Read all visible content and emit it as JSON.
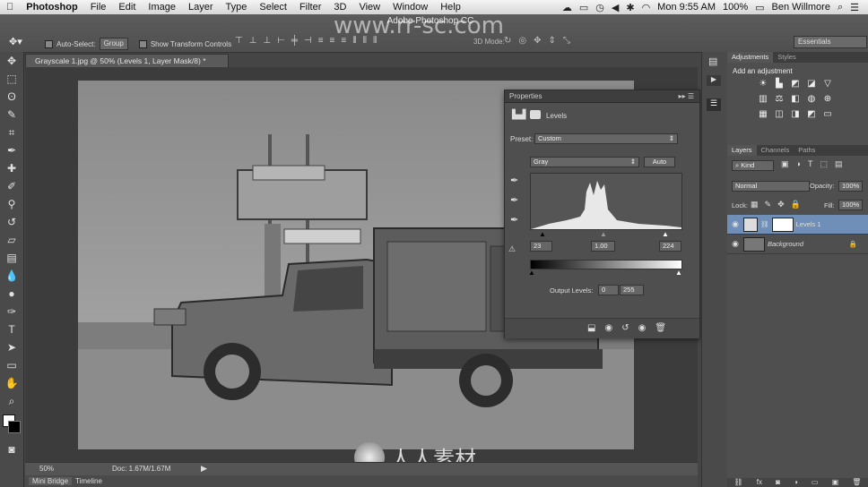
{
  "menubar": {
    "apple": "",
    "app": "Photoshop",
    "items": [
      "File",
      "Edit",
      "Image",
      "Layer",
      "Type",
      "Select",
      "Filter",
      "3D",
      "View",
      "Window",
      "Help"
    ],
    "clock": "Mon 9:55 AM",
    "battery": "100%",
    "user": "Ben Willmore"
  },
  "app_title": "Adobe Photoshop CC",
  "options": {
    "auto_select": "Auto-Select:",
    "auto_select_value": "Group",
    "show_transform": "Show Transform Controls",
    "mode3d": "3D Mode:",
    "workspace": "Essentials"
  },
  "document": {
    "tab_title": "Grayscale 1.jpg @ 50% (Levels 1, Layer Mask/8) *",
    "zoom": "50%",
    "doc_info": "Doc: 1.67M/1.67M"
  },
  "bottom_tabs": [
    "Mini Bridge",
    "Timeline"
  ],
  "properties": {
    "panel_title": "Properties",
    "section": "Levels",
    "preset_label": "Preset:",
    "preset_value": "Custom",
    "channel": "Gray",
    "auto": "Auto",
    "input_black": "23",
    "input_gamma": "1.00",
    "input_white": "224",
    "output_label": "Output Levels:",
    "output_black": "0",
    "output_white": "255"
  },
  "adjustments": {
    "tab_active": "Adjustments",
    "tab_other": "Styles",
    "heading": "Add an adjustment"
  },
  "layers": {
    "tabs": [
      "Layers",
      "Channels",
      "Paths"
    ],
    "kind": "Kind",
    "blend_mode": "Normal",
    "opacity_label": "Opacity:",
    "opacity": "100%",
    "lock_label": "Lock:",
    "fill_label": "Fill:",
    "fill": "100%",
    "items": [
      {
        "name": "Levels 1",
        "selected": true
      },
      {
        "name": "Background",
        "selected": false
      }
    ]
  },
  "watermarks": {
    "url": "www.rr-sc.com",
    "logo_text": "人人素材"
  },
  "colors": {
    "panel_bg": "#4f4f4f",
    "selected_layer": "#6f8fb8",
    "menubar": "#e6e6e6"
  }
}
